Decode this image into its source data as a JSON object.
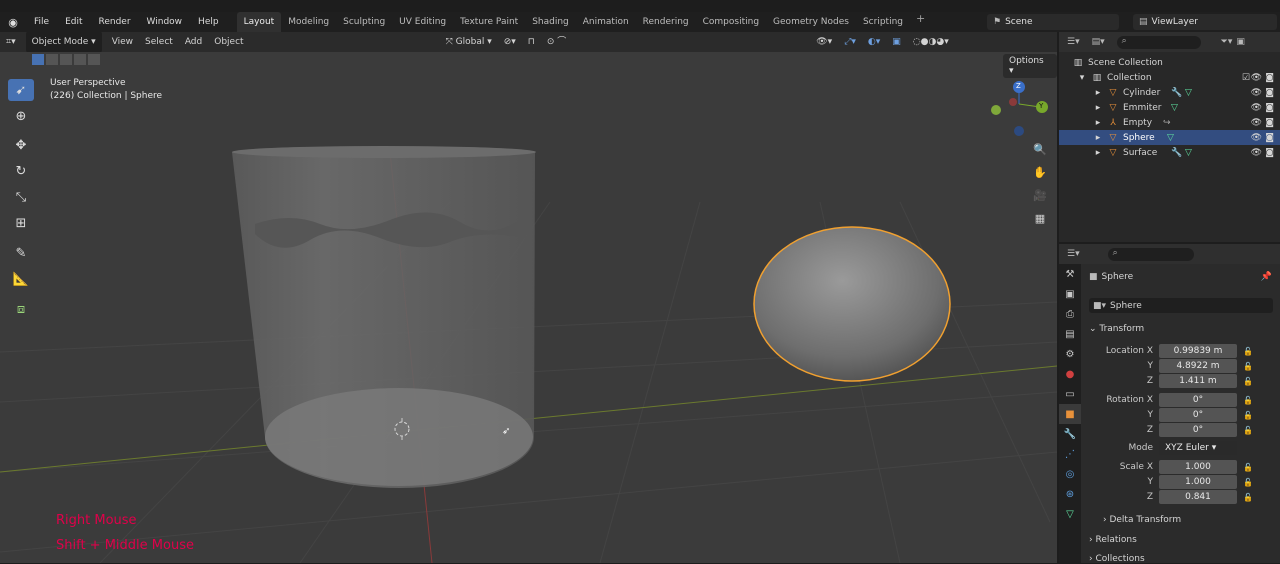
{
  "menu": [
    "File",
    "Edit",
    "Render",
    "Window",
    "Help"
  ],
  "workspaces": [
    "Layout",
    "Modeling",
    "Sculpting",
    "UV Editing",
    "Texture Paint",
    "Shading",
    "Animation",
    "Rendering",
    "Compositing",
    "Geometry Nodes",
    "Scripting"
  ],
  "scene": "Scene",
  "view_layer": "ViewLayer",
  "header": {
    "mode": "Object Mode",
    "view": "View",
    "select": "Select",
    "add": "Add",
    "object": "Object",
    "orientation": "Global",
    "options": "Options"
  },
  "viewport": {
    "perspective": "User Perspective",
    "collection_info": "(226) Collection | Sphere",
    "hint1": "Right Mouse",
    "hint2": "Shift + Middle Mouse",
    "gizmo_z": "Z",
    "gizmo_y": "Y"
  },
  "outliner": {
    "title": "Scene Collection",
    "collection": "Collection",
    "items": [
      {
        "name": "Cylinder"
      },
      {
        "name": "Emmiter"
      },
      {
        "name": "Empty"
      },
      {
        "name": "Sphere"
      },
      {
        "name": "Surface"
      }
    ]
  },
  "properties": {
    "object_name": "Sphere",
    "data_name": "Sphere",
    "transform_label": "Transform",
    "location_label": "Location X",
    "loc_x": "0.99839 m",
    "loc_y": "4.8922 m",
    "loc_z": "1.411 m",
    "rotation_label": "Rotation X",
    "rot_x": "0°",
    "rot_y": "0°",
    "rot_z": "0°",
    "mode_label": "Mode",
    "mode_value": "XYZ Euler",
    "scale_label": "Scale X",
    "scale_x": "1.000",
    "scale_y": "1.000",
    "scale_z": "0.841",
    "y_label": "Y",
    "z_label": "Z",
    "delta_transform": "Delta Transform",
    "relations": "Relations",
    "collections": "Collections"
  },
  "colors": {
    "accent": "#4772b3",
    "selection_outline": "#f0a030",
    "hint_text": "#e0004a"
  }
}
